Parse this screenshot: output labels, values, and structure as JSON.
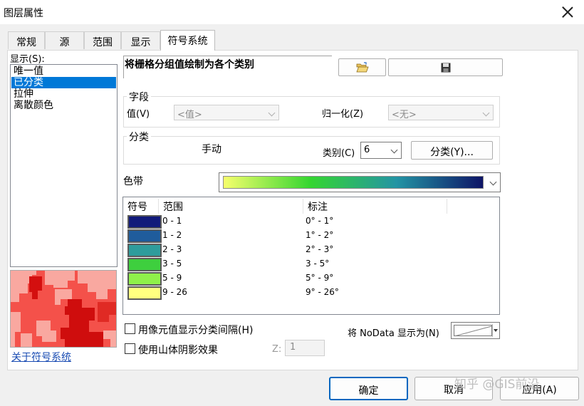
{
  "window": {
    "title": "图层属性"
  },
  "tabs": [
    "常规",
    "源",
    "范围",
    "显示",
    "符号系统"
  ],
  "show": {
    "label": "显示(S):",
    "items": [
      "唯一值",
      "已分类",
      "拉伸",
      "离散颜色"
    ],
    "selected": "已分类"
  },
  "about_link": "关于符号系统",
  "description": "将栅格分组值绘制为各个类别",
  "fields": {
    "group_title": "字段",
    "value_label": "值(V)",
    "value_selected": "<值>",
    "normalize_label": "归一化(Z)",
    "normalize_selected": "<无>"
  },
  "classification": {
    "group_title": "分类",
    "method": "手动",
    "classes_label": "类别(C)",
    "classes_value": "6",
    "classify_button": "分类(Y)..."
  },
  "color_ramp": {
    "label": "色带",
    "colors": [
      "#f6ff6c",
      "#35d630",
      "#2394a4",
      "#0d1466"
    ]
  },
  "table": {
    "headers": [
      "符号",
      "范围",
      "标注"
    ],
    "rows": [
      {
        "color": "#111a7a",
        "range": "0 - 1",
        "label": "0° - 1°"
      },
      {
        "color": "#1f5c9c",
        "range": "1 - 2",
        "label": "1° - 2°"
      },
      {
        "color": "#2e9c9c",
        "range": "2 - 3",
        "label": "2° - 3°"
      },
      {
        "color": "#3ecf3e",
        "range": "3 - 5",
        "label": "3 - 5°"
      },
      {
        "color": "#8ff04a",
        "range": "5 - 9",
        "label": "5° - 9°"
      },
      {
        "color": "#ffff80",
        "range": "9 - 26",
        "label": "9° - 26°"
      }
    ]
  },
  "options": {
    "use_pixel_intervals": "用像元值显示分类间隔(H)",
    "use_hillshade": "使用山体阴影效果",
    "z_label": "Z:",
    "z_value": "1",
    "nodata_label": "将 NoData 显示为(N)"
  },
  "buttons": {
    "ok": "确定",
    "cancel": "取消",
    "apply": "应用(A)"
  },
  "icons": {
    "open": "folder-open-icon",
    "save": "floppy-disk-icon",
    "close": "close-icon"
  },
  "watermark": "知乎 @GIS前沿"
}
